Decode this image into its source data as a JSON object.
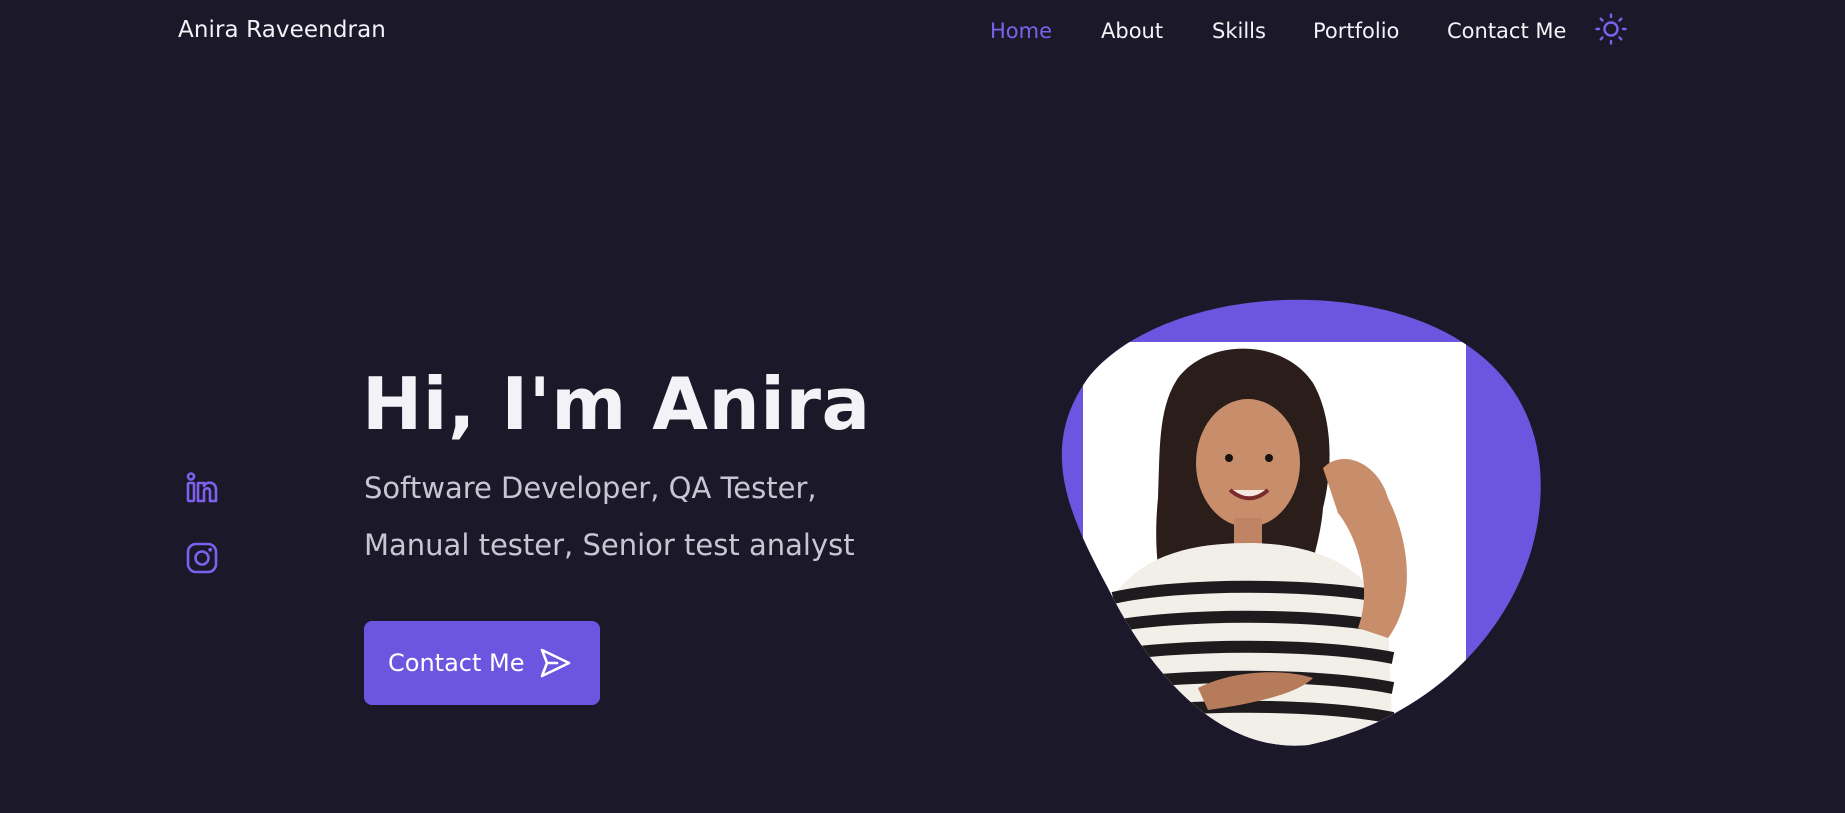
{
  "header": {
    "brand": "Anira Raveendran",
    "nav": [
      {
        "label": "Home",
        "active": true
      },
      {
        "label": "About",
        "active": false
      },
      {
        "label": "Skills",
        "active": false
      },
      {
        "label": "Portfolio",
        "active": false
      },
      {
        "label": "Contact Me",
        "active": false
      }
    ],
    "theme_toggle_icon": "sun-icon"
  },
  "social": [
    {
      "icon": "linkedin-icon"
    },
    {
      "icon": "instagram-icon"
    }
  ],
  "hero": {
    "title": "Hi, I'm Anira",
    "subtitle_line1": "Software Developer, QA Tester,",
    "subtitle_line2": "Manual tester, Senior test analyst",
    "cta_label": "Contact Me",
    "cta_icon": "send-icon"
  },
  "colors": {
    "background": "#1b1829",
    "accent": "#6c56e0",
    "active_link": "#7b61ec",
    "text": "#f2f2f7",
    "muted_text": "#c8c6d2"
  }
}
